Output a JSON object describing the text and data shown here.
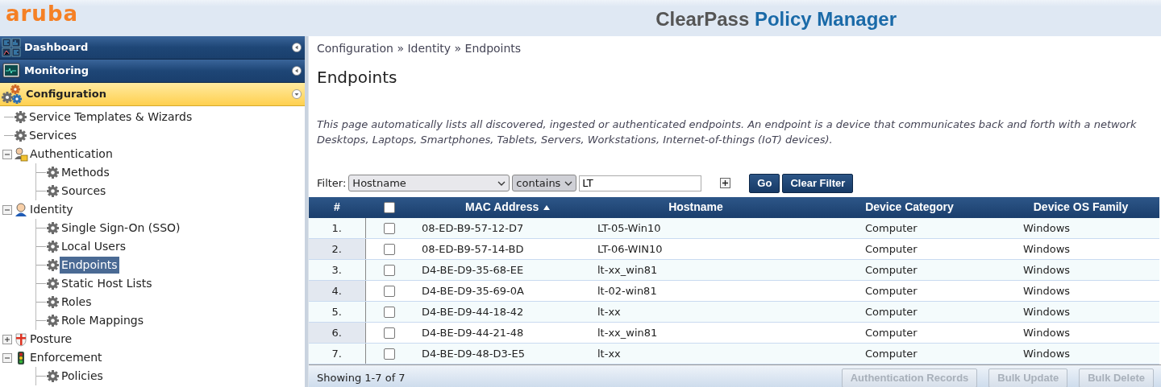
{
  "header": {
    "logo": "aruba",
    "product_title": {
      "first": "ClearPass",
      "second": "Policy Manager"
    }
  },
  "nav_sections": [
    {
      "label": "Dashboard",
      "kind": "dashboard",
      "expanded": false
    },
    {
      "label": "Monitoring",
      "kind": "monitoring",
      "expanded": false
    },
    {
      "label": "Configuration",
      "kind": "configuration",
      "expanded": true
    }
  ],
  "tree": [
    {
      "label": "Service Templates & Wizards",
      "kind": "gear",
      "selected": false
    },
    {
      "label": "Services",
      "kind": "gear",
      "selected": false
    },
    {
      "label": "Authentication",
      "kind": "authentication",
      "selected": false,
      "expanded": true,
      "children": [
        {
          "label": "Methods",
          "kind": "gear",
          "selected": false
        },
        {
          "label": "Sources",
          "kind": "gear",
          "selected": false
        }
      ]
    },
    {
      "label": "Identity",
      "kind": "identity",
      "selected": false,
      "expanded": true,
      "children": [
        {
          "label": "Single Sign-On (SSO)",
          "kind": "gear",
          "selected": false
        },
        {
          "label": "Local Users",
          "kind": "gear",
          "selected": false
        },
        {
          "label": "Endpoints",
          "kind": "gear",
          "selected": true
        },
        {
          "label": "Static Host Lists",
          "kind": "gear",
          "selected": false
        },
        {
          "label": "Roles",
          "kind": "gear",
          "selected": false
        },
        {
          "label": "Role Mappings",
          "kind": "gear",
          "selected": false
        }
      ]
    },
    {
      "label": "Posture",
      "kind": "posture",
      "selected": false,
      "expanded": false
    },
    {
      "label": "Enforcement",
      "kind": "enforcement",
      "selected": false,
      "expanded": true,
      "children": [
        {
          "label": "Policies",
          "kind": "gear",
          "selected": false
        }
      ]
    }
  ],
  "breadcrumb": [
    "Configuration",
    "Identity",
    "Endpoints"
  ],
  "breadcrumb_separator": "»",
  "page_title": "Endpoints",
  "description_lines": [
    "This page automatically lists all discovered, ingested or authenticated endpoints. An endpoint is a device that communicates back and forth with a network",
    "Desktops, Laptops, Smartphones, Tablets, Servers, Workstations, Internet-of-things (IoT) devices)."
  ],
  "filter": {
    "label": "Filter:",
    "field": "Hostname",
    "operator": "contains",
    "value": "LT",
    "buttons": [
      "Go",
      "Clear Filter"
    ]
  },
  "table": {
    "columns": [
      {
        "label": "#",
        "sorted": false
      },
      {
        "kind": "checkbox",
        "checked": false
      },
      {
        "label": "MAC Address",
        "sorted": true
      },
      {
        "label": "Hostname",
        "sorted": false
      },
      {
        "label": "Device Category",
        "sorted": false
      },
      {
        "label": "Device OS Family",
        "sorted": false
      }
    ],
    "rows": [
      {
        "number": "1.",
        "checked": false,
        "mac": "08-ED-B9-57-12-D7",
        "hostname": "LT-05-Win10",
        "category": "Computer",
        "os_family": "Windows"
      },
      {
        "number": "2.",
        "checked": false,
        "mac": "08-ED-B9-57-14-BD",
        "hostname": "LT-06-WIN10",
        "category": "Computer",
        "os_family": "Windows"
      },
      {
        "number": "3.",
        "checked": false,
        "mac": "D4-BE-D9-35-68-EE",
        "hostname": "lt-xx_win81",
        "category": "Computer",
        "os_family": "Windows"
      },
      {
        "number": "4.",
        "checked": false,
        "mac": "D4-BE-D9-35-69-0A",
        "hostname": "lt-02-win81",
        "category": "Computer",
        "os_family": "Windows"
      },
      {
        "number": "5.",
        "checked": false,
        "mac": "D4-BE-D9-44-18-42",
        "hostname": "lt-xx",
        "category": "Computer",
        "os_family": "Windows"
      },
      {
        "number": "6.",
        "checked": false,
        "mac": "D4-BE-D9-44-21-48",
        "hostname": "lt-xx_win81",
        "category": "Computer",
        "os_family": "Windows"
      },
      {
        "number": "7.",
        "checked": false,
        "mac": "D4-BE-D9-48-D3-E5",
        "hostname": "lt-xx",
        "category": "Computer",
        "os_family": "Windows"
      }
    ]
  },
  "footer": {
    "summary": "Showing 1-7 of 7",
    "buttons": [
      {
        "label": "Authentication Records",
        "disabled": true
      },
      {
        "label": "Bulk Update",
        "disabled": true
      },
      {
        "label": "Bulk Delete",
        "disabled": true
      }
    ]
  }
}
